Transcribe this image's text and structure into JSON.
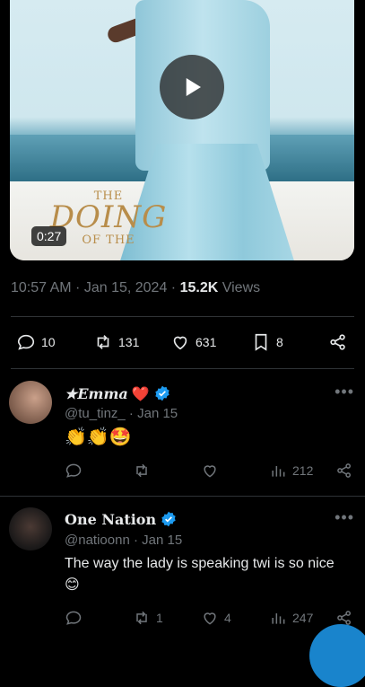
{
  "video": {
    "duration": "0:27",
    "title_lines": [
      "THE",
      "DOING",
      "OF THE"
    ]
  },
  "tweet_meta": {
    "time": "10:57 AM",
    "date": "Jan 15, 2024",
    "views_count": "15.2K",
    "views_label": "Views"
  },
  "tweet_actions": {
    "replies": "10",
    "reposts": "131",
    "likes": "631",
    "bookmarks": "8"
  },
  "replies": [
    {
      "display_name": "★Emma",
      "handle": "@tu_tinz_",
      "date": "Jan 15",
      "text": "👏👏🤩",
      "retweets": "",
      "likes": "",
      "views": "212",
      "name_suffix_emoji": "❤️",
      "verified_color": "#1d9bf0"
    },
    {
      "display_name": "One Nation",
      "handle": "@natioonn",
      "date": "Jan 15",
      "text": "The way the lady is speaking twi is so nice 😊",
      "retweets": "1",
      "likes": "4",
      "views": "247",
      "verified_color": "#1d9bf0"
    }
  ],
  "colors": {
    "background": "#000000",
    "text_primary": "#e7e9ea",
    "text_secondary": "#71767b",
    "accent": "#1d9bf0",
    "divider": "#2f3336"
  }
}
